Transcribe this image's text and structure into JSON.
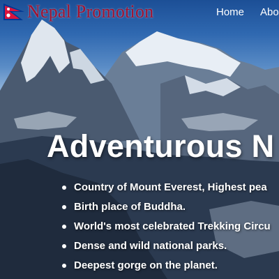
{
  "brand": {
    "name": "Nepal Promotion",
    "logo_icon": "nepal-flag-icon"
  },
  "nav": {
    "items": [
      {
        "label": "Home"
      },
      {
        "label": "Abo"
      }
    ]
  },
  "hero": {
    "headline": "Adventurous N",
    "background": "snow-capped-himalaya-mountains",
    "features": [
      "Country of Mount Everest, Highest pea",
      "Birth place of Buddha.",
      "World's most celebrated Trekking Circu",
      "Dense and wild national parks.",
      "Deepest gorge on the planet."
    ]
  },
  "colors": {
    "brand_text": "#a11230",
    "flag_red": "#dc143c",
    "flag_blue": "#003893",
    "text": "#ffffff"
  }
}
